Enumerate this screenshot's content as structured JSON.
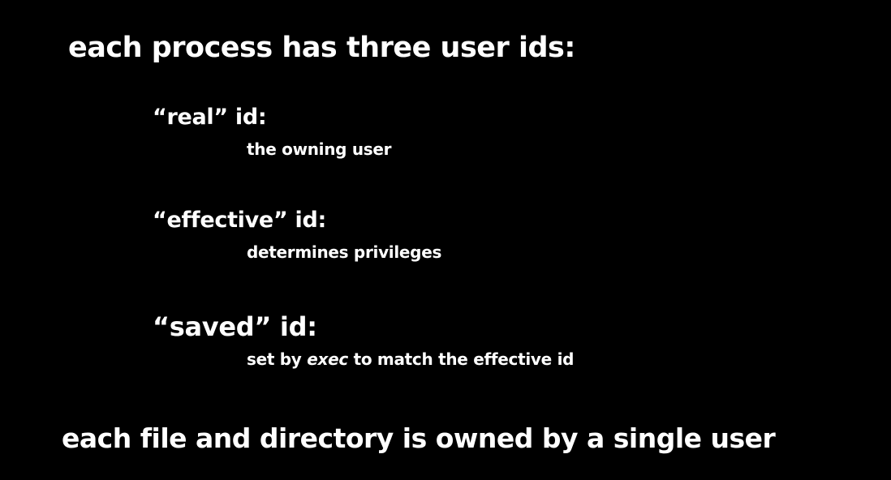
{
  "slide": {
    "heading": "each process has three user ids:",
    "ids": [
      {
        "term": "“real” id:",
        "description": "the owning user"
      },
      {
        "term": "“effective” id:",
        "description": "determines privileges"
      },
      {
        "term": "“saved” id:",
        "description_before": "set by ",
        "description_emphasis": "exec",
        "description_after": " to match the effective id"
      }
    ],
    "footer": "each file and directory is owned by a single user"
  },
  "colors": {
    "background": "#000000",
    "text": "#ffffff"
  }
}
